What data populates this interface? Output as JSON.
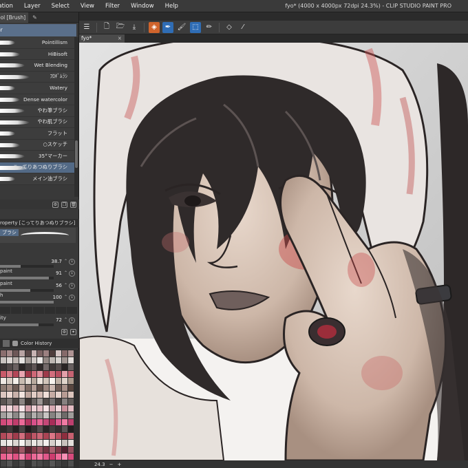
{
  "menu": {
    "items": [
      "nation",
      "Layer",
      "Select",
      "View",
      "Filter",
      "Window",
      "Help"
    ]
  },
  "window_title": "fyo* (4000 x 4000px 72dpi 24.3%) - CLIP STUDIO PAINT PRO",
  "left_panel": {
    "tab_label": "ool [Brush]",
    "header": "or",
    "brushes": [
      {
        "label": "Pointillism",
        "selected": false
      },
      {
        "label": "HiBisoft",
        "selected": false
      },
      {
        "label": "Wet Blending",
        "selected": false
      },
      {
        "label": "ﾌﾛｷﾞﾑﾗｼ",
        "selected": false
      },
      {
        "label": "Watery",
        "selected": false
      },
      {
        "label": "Dense watercolor",
        "selected": false
      },
      {
        "label": "やわ筆ブラシ",
        "selected": false
      },
      {
        "label": "やわ肌ブラシ",
        "selected": false
      },
      {
        "label": "フラット",
        "selected": false
      },
      {
        "label": "○スケッチ",
        "selected": false
      },
      {
        "label": "35°マーカー",
        "selected": false
      },
      {
        "label": "こってりあつぬりブラシ",
        "selected": true
      },
      {
        "label": "メイン油ブラシ",
        "selected": false
      }
    ],
    "property_header": "roperty [こってりあつぬりブラシ]",
    "preview_label": "ブラシ",
    "properties": [
      {
        "name": "",
        "value": "38.7",
        "fill": 0.39
      },
      {
        "name": "paint",
        "value": "91",
        "fill": 0.91
      },
      {
        "name": "paint",
        "value": "56",
        "fill": 0.56
      },
      {
        "name": "h",
        "value": "100",
        "fill": 1.0
      },
      {
        "name": "ity",
        "value": "72",
        "fill": 0.72
      }
    ],
    "palette_tab": "Color History"
  },
  "toolbar": {
    "icons": [
      "menu-icon",
      "new-file-icon",
      "open-icon",
      "save-icon",
      "clip-studio-icon",
      "pen-tool-icon",
      "brush-icon",
      "transform-icon",
      "pencil-icon",
      "eraser-icon",
      "eyedropper-icon"
    ]
  },
  "document_tab": "fyo*",
  "status": {
    "zoom": "24.3",
    "minus": "−",
    "plus": "+"
  },
  "palette_colors": [
    "#8a6e6e",
    "#a58a8a",
    "#6d5757",
    "#b8a3a3",
    "#5a4848",
    "#c7b3b3",
    "#7a6262",
    "#9b8080",
    "#4f3c3c",
    "#d4c2c2",
    "#866a6a",
    "#ad9292",
    "#c9c3c0",
    "#dcd6d3",
    "#b9b1ad",
    "#e8e4e2",
    "#a69c98",
    "#cfc8c5",
    "#ece9e7",
    "#928783",
    "#bfb7b3",
    "#d8d2cf",
    "#a09591",
    "#e2dcd9",
    "#3a3434",
    "#524a4a",
    "#6a6060",
    "#2c2626",
    "#463e3e",
    "#5e5454",
    "#302a2a",
    "#726868",
    "#403838",
    "#564c4c",
    "#2a2424",
    "#686060",
    "#c95a6a",
    "#d87a88",
    "#b34657",
    "#e8a5b0",
    "#a03848",
    "#cf6877",
    "#e08e9b",
    "#9e3a4a",
    "#d26e7d",
    "#b84f60",
    "#e3a0aa",
    "#c56372",
    "#efe9e4",
    "#d9cfc6",
    "#f4efe9",
    "#c8bcb1",
    "#e4dbd3",
    "#b8aa9e",
    "#ece4dc",
    "#d1c5ba",
    "#f8f4ef",
    "#c0b2a6",
    "#e0d6cc",
    "#a9998c",
    "#8c7a72",
    "#a69088",
    "#6e5c55",
    "#c1aba3",
    "#7d6a62",
    "#b39d95",
    "#5f4e48",
    "#9b867e",
    "#cdb9b1",
    "#715e57",
    "#a89189",
    "#57463f",
    "#dcc6c0",
    "#ecd8d2",
    "#c9b1aa",
    "#f3e4df",
    "#bfa59d",
    "#e2cdc6",
    "#d5bcb5",
    "#f0ded8",
    "#c6aca4",
    "#e7d3cc",
    "#b89c94",
    "#dbc4bc",
    "#5b5452",
    "#7b7371",
    "#4a4341",
    "#8c8583",
    "#3d3634",
    "#6a6361",
    "#9d9694",
    "#534c4a",
    "#767070",
    "#45403e",
    "#878180",
    "#615b59",
    "#e9c9cf",
    "#f2d9dd",
    "#dcb3bb",
    "#f7e6e9",
    "#d19ea8",
    "#ecd0d5",
    "#e4bec5",
    "#f5e0e3",
    "#d7a9b2",
    "#efd4d9",
    "#c98f9a",
    "#e2bcc3",
    "#a3a09e",
    "#bdbab8",
    "#8c8987",
    "#d0cdcb",
    "#7a7775",
    "#b1aeac",
    "#999694",
    "#c7c4c2",
    "#868381",
    "#aeaba9",
    "#6e6b69",
    "#9f9c9a",
    "#d24a7a",
    "#e0578a",
    "#c03d6c",
    "#ec6a98",
    "#b5345f",
    "#d8508a",
    "#e66493",
    "#c44777",
    "#a82d58",
    "#de5a8f",
    "#f07aa3",
    "#be3f6f",
    "#2f2a2b",
    "#3f393a",
    "#262122",
    "#4b4445",
    "#1f1b1c",
    "#372f31",
    "#554e4f",
    "#2a2526",
    "#443d3e",
    "#342e2f",
    "#5c5556",
    "#231f20",
    "#b24a5a",
    "#c55c6c",
    "#a03c4c",
    "#d26e7e",
    "#943444",
    "#be5666",
    "#cc6676",
    "#aa4454",
    "#dc7686",
    "#b85060",
    "#8e2e3e",
    "#c86070",
    "#e6e2df",
    "#f0ece9",
    "#dbd6d2",
    "#f6f3f1",
    "#d1cbc7",
    "#ebe7e4",
    "#e0dbd8",
    "#f3efed",
    "#d6d0cc",
    "#ede9e6",
    "#c9c2be",
    "#e3dedb",
    "#7c3a48",
    "#8e4856",
    "#6a2e3b",
    "#a05866",
    "#5c2633",
    "#86404e",
    "#985260",
    "#723442",
    "#aa6270",
    "#803a48",
    "#522030",
    "#94505e",
    "#e85f8e",
    "#f06f9c",
    "#de5182",
    "#f584ac",
    "#d44577",
    "#ea6896",
    "#f27aa4",
    "#e0578a",
    "#cc3c6e",
    "#ee6a98",
    "#f890b6",
    "#d64a7c",
    "#444",
    "#555",
    "#3a3a3a",
    "#4c4c4c",
    "#333",
    "#505050",
    "#484848",
    "#3e3e3e",
    "#565656",
    "#424242",
    "#383838",
    "#4e4e4e",
    "#3a3a3a",
    "#444",
    "#333",
    "#4a4a4a",
    "#2e2e2e",
    "#404040",
    "#3c3c3c",
    "#363636",
    "#464646",
    "#3e3e3e",
    "#303030",
    "#424242"
  ]
}
